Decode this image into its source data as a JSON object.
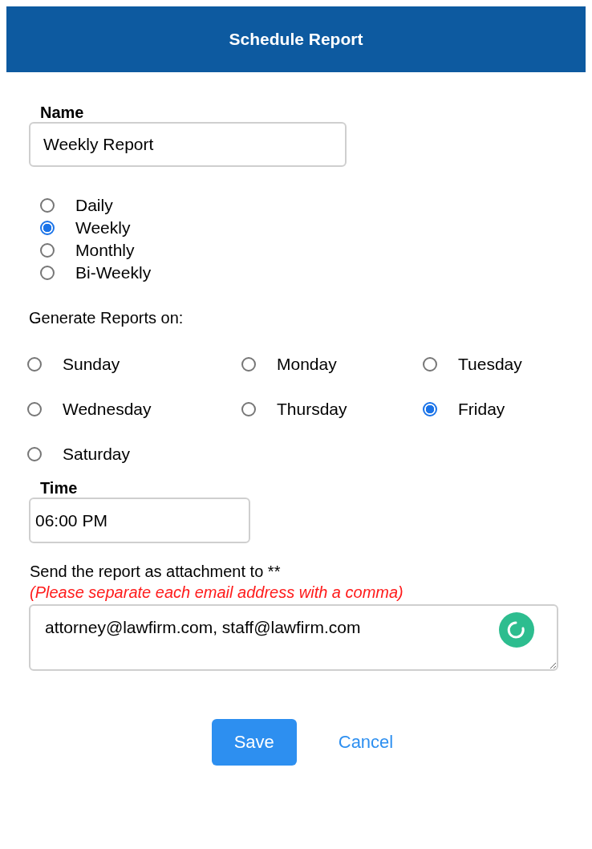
{
  "header": {
    "title": "Schedule Report"
  },
  "name_field": {
    "label": "Name",
    "value": "Weekly Report"
  },
  "frequency": [
    {
      "label": "Daily",
      "selected": false
    },
    {
      "label": "Weekly",
      "selected": true
    },
    {
      "label": "Monthly",
      "selected": false
    },
    {
      "label": "Bi-Weekly",
      "selected": false
    }
  ],
  "days": {
    "label": "Generate Reports on:",
    "options": [
      {
        "label": "Sunday",
        "selected": false
      },
      {
        "label": "Monday",
        "selected": false
      },
      {
        "label": "Tuesday",
        "selected": false
      },
      {
        "label": "Wednesday",
        "selected": false
      },
      {
        "label": "Thursday",
        "selected": false
      },
      {
        "label": "Friday",
        "selected": true
      },
      {
        "label": "Saturday",
        "selected": false
      }
    ]
  },
  "time_field": {
    "label": "Time",
    "value": "06:00 PM"
  },
  "recipients": {
    "label": "Send the report as attachment to **",
    "hint": "(Please separate each email address with a comma)",
    "value": "attorney@lawfirm.com, staff@lawfirm.com"
  },
  "buttons": [
    {
      "label": "Save",
      "kind": "primary"
    },
    {
      "label": "Cancel",
      "kind": "link"
    }
  ]
}
